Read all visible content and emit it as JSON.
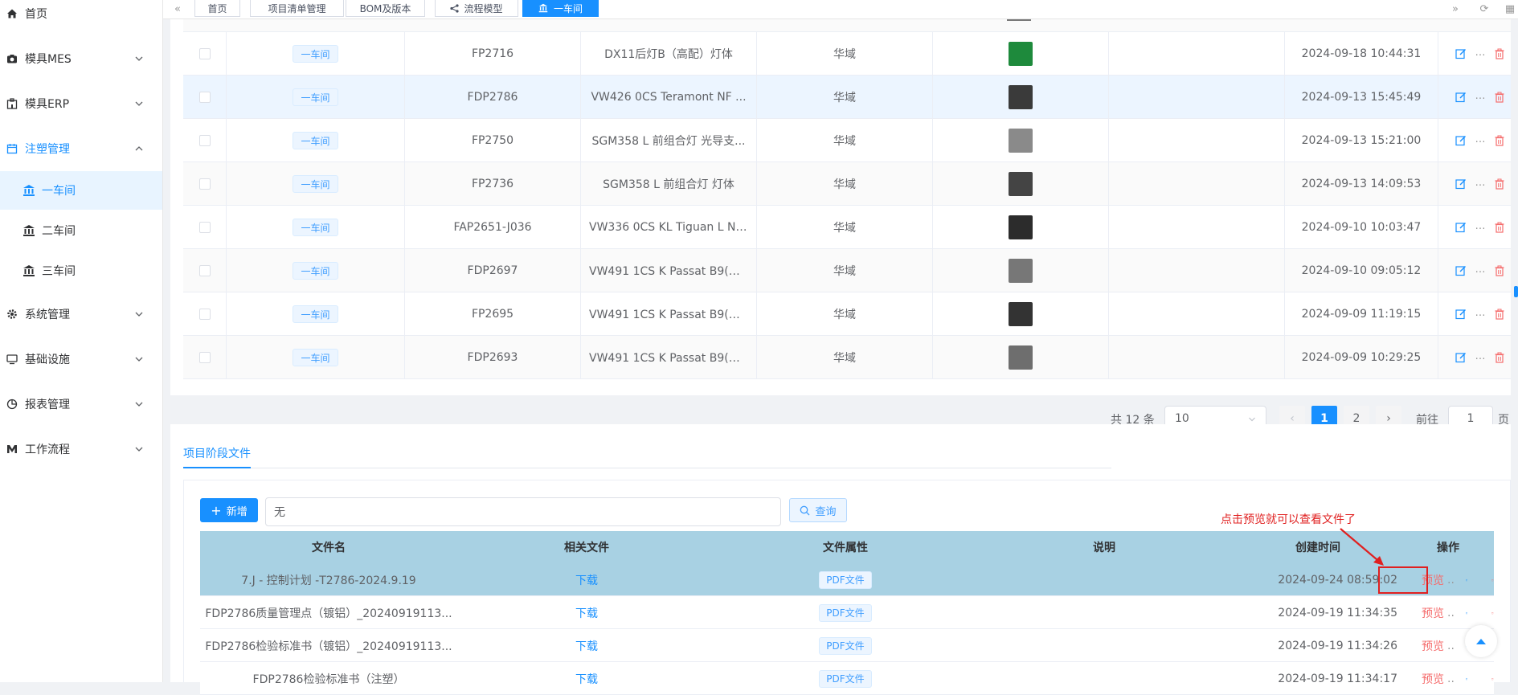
{
  "sidebar": {
    "items": [
      {
        "label": "首页",
        "icon": "home-icon"
      },
      {
        "label": "模具MES",
        "icon": "camera-icon"
      },
      {
        "label": "模具ERP",
        "icon": "building-icon"
      },
      {
        "label": "注塑管理",
        "icon": "calendar-icon",
        "expanded": true
      },
      {
        "label": "系统管理",
        "icon": "gear-icon"
      },
      {
        "label": "基础设施",
        "icon": "monitor-icon"
      },
      {
        "label": "报表管理",
        "icon": "pie-chart-icon"
      },
      {
        "label": "工作流程",
        "icon": "workflow-icon"
      }
    ],
    "sub_items": [
      {
        "label": "一车间",
        "active": true
      },
      {
        "label": "二车间"
      },
      {
        "label": "三车间"
      }
    ]
  },
  "tabs": [
    {
      "label": "首页"
    },
    {
      "label": "项目清单管理"
    },
    {
      "label": "BOM及版本"
    },
    {
      "label": "流程模型"
    },
    {
      "label": "一车间",
      "active": true
    }
  ],
  "grid_rows": [
    {
      "workshop": "一车间",
      "code": "FP2716",
      "name": "DX11后灯B（高配）灯体",
      "customer": "华域",
      "thumb_color": "#1e8a3c",
      "time": "2024-09-18 10:44:31"
    },
    {
      "workshop": "一车间",
      "code": "FDP2786",
      "name": "VW426 0CS Teramont NF ...",
      "customer": "华域",
      "thumb_color": "#3a3a3a",
      "time": "2024-09-13 15:45:49"
    },
    {
      "workshop": "一车间",
      "code": "FP2750",
      "name": "SGM358 L 前组合灯 光导支...",
      "customer": "华域",
      "thumb_color": "#8a8a8a",
      "time": "2024-09-13 15:21:00"
    },
    {
      "workshop": "一车间",
      "code": "FP2736",
      "name": "SGM358 L 前组合灯 灯体",
      "customer": "华域",
      "thumb_color": "#444444",
      "time": "2024-09-13 14:09:53"
    },
    {
      "workshop": "一车间",
      "code": "FAP2651-J036",
      "name": "VW336 0CS KL Tiguan L NF...",
      "customer": "华域",
      "thumb_color": "#2c2c2c",
      "time": "2024-09-10 10:03:47"
    },
    {
      "workshop": "一车间",
      "code": "FDP2697",
      "name": "VW491 1CS K Passat B9(高...",
      "customer": "华域",
      "thumb_color": "#777777",
      "time": "2024-09-10 09:05:12"
    },
    {
      "workshop": "一车间",
      "code": "FP2695",
      "name": "VW491 1CS K Passat B9(高...",
      "customer": "华域",
      "thumb_color": "#333333",
      "time": "2024-09-09 11:19:15"
    },
    {
      "workshop": "一车间",
      "code": "FDP2693",
      "name": "VW491 1CS K Passat B9(高...",
      "customer": "华域",
      "thumb_color": "#6e6e6e",
      "time": "2024-09-09 10:29:25"
    }
  ],
  "pagination": {
    "total": "共 12 条",
    "page_size": "10",
    "pages": [
      "1",
      "2"
    ],
    "current": "1",
    "goto_label": "前往",
    "goto_value": "1",
    "page_suffix": "页"
  },
  "files": {
    "tab_label": "项目阶段文件",
    "add_label": "新增",
    "search_value": "无",
    "query_label": "查询",
    "headers": [
      "文件名",
      "相关文件",
      "文件属性",
      "说明",
      "创建时间",
      "操作"
    ],
    "rows": [
      {
        "name": "7.J - 控制计划 -T2786-2024.9.19",
        "related": "下载",
        "attr": "PDF文件",
        "note": "",
        "time": "2024-09-24 08:59:02",
        "preview": "预览"
      },
      {
        "name": "FDP2786质量管理点（镀铝）_20240919113...",
        "related": "下载",
        "attr": "PDF文件",
        "note": "",
        "time": "2024-09-19 11:34:35",
        "preview": "预览"
      },
      {
        "name": "FDP2786检验标准书（镀铝）_20240919113...",
        "related": "下载",
        "attr": "PDF文件",
        "note": "",
        "time": "2024-09-19 11:34:26",
        "preview": "预览"
      },
      {
        "name": "FDP2786检验标准书（注塑）",
        "related": "下载",
        "attr": "PDF文件",
        "note": "",
        "time": "2024-09-19 11:34:17",
        "preview": "预览"
      }
    ]
  },
  "annotation": {
    "text": "点击预览就可以查看文件了"
  },
  "colors": {
    "primary": "#1890ff",
    "danger": "#f56c6c",
    "annotation": "#e02020",
    "selected_row": "#a8d1e3"
  }
}
